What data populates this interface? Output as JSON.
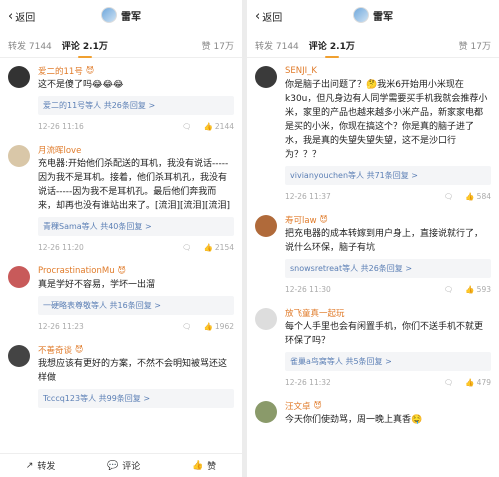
{
  "nav": {
    "back_label": "返回",
    "title": "雷军"
  },
  "tabs": {
    "repost": "转发 7144",
    "comment": "评论 2.1万",
    "like": "赞 17万"
  },
  "left_comments": [
    {
      "name": "爱二的11号",
      "badge": "😈",
      "text": "这不是傻了吗😂😂😂",
      "replies": "爱二的11号等人 共26条回复 >",
      "date": "12-26 11:16",
      "likes": "2144",
      "avatar_color": "#333333"
    },
    {
      "name": "月流晖love",
      "badge": "",
      "text": "充电器:开始他们杀配送的耳机，我没有说话-----因为我不是耳机。接着，他们杀耳机孔，我没有说话-----因为我不是耳机孔。最后他们奔我而来，却再也没有谁站出来了。[流泪][流泪][流泪]",
      "replies": "青稞Sama等人 共40条回复 >",
      "date": "12-26 11:20",
      "likes": "2154",
      "avatar_color": "#d9c7a8"
    },
    {
      "name": "ProcrastinationMu",
      "badge": "😈",
      "text": "真是学好不容易，学坏一出溜",
      "replies": "一硬略表尊敬等人 共16条回复 >",
      "date": "12-26 11:23",
      "likes": "1962",
      "avatar_color": "#c85a5a"
    },
    {
      "name": "不善奇谈",
      "badge": "😈",
      "text": "我想应该有更好的方案，不然不会明知被骂还这样做",
      "replies": "Tcccq123等人 共99条回复 >",
      "date": "",
      "likes": "",
      "avatar_color": "#444444"
    }
  ],
  "right_comments": [
    {
      "name": "SENJI_K",
      "badge": "",
      "text": "你是脑子出问题了？🤔我米6开始用小米现在k30u，但凡身边有人同学需要买手机我就会推荐小米，家里的产品也越来越多小米产品，新家家电都是买的小米，你现在搞这个？你是真的脑子进了水，我是真的失望失望失望，这不是沙口行为？？？",
      "replies": "vivianyouchen等人 共71条回复 >",
      "date": "12-26 11:37",
      "likes": "584",
      "avatar_color": "#3a3a3a"
    },
    {
      "name": "寿可law",
      "badge": "😈",
      "text": "把充电器的成本转嫁到用户身上，直接说就行了，说什么环保，脑子有坑",
      "replies": "snowsretreat等人 共26条回复 >",
      "date": "12-26 11:30",
      "likes": "593",
      "avatar_color": "#b06a3a"
    },
    {
      "name": "放飞童真一起玩",
      "badge": "",
      "text": "每个人手里也会有闲置手机，你们不送手机不就更环保了吗？",
      "replies": "雀巢a鸟窝等人 共5条回复 >",
      "date": "12-26 11:32",
      "likes": "479",
      "avatar_color": "#dddddd"
    },
    {
      "name": "汪文卓",
      "badge": "😈",
      "text": "今天你们使劲骂，周一晚上真香🤤",
      "replies": "",
      "date": "",
      "likes": "",
      "avatar_color": "#8a9a6a"
    }
  ],
  "bottom_bar": {
    "repost": "转发",
    "comment": "评论",
    "like": "赞"
  }
}
